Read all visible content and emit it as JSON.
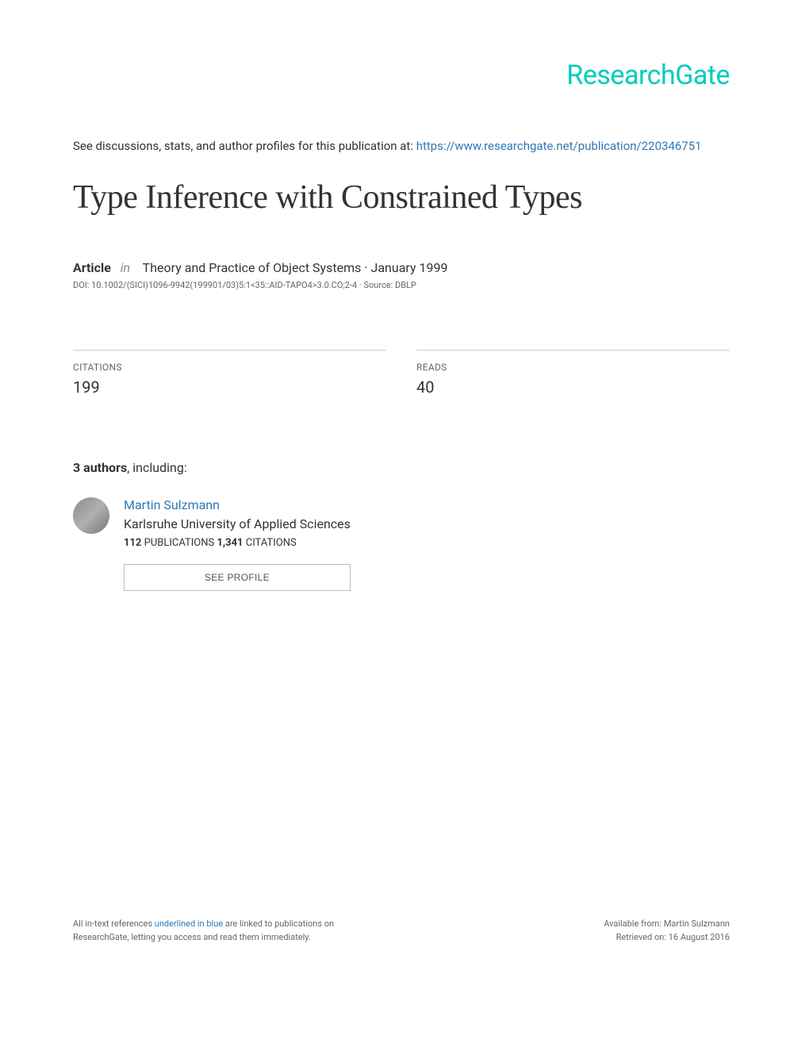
{
  "logo": "ResearchGate",
  "discussion": {
    "prefix": "See discussions, stats, and author profiles for this publication at: ",
    "url": "https://www.researchgate.net/publication/220346751"
  },
  "title": "Type Inference with Constrained Types",
  "meta": {
    "type": "Article",
    "in_word": "in",
    "journal": "Theory and Practice of Object Systems · January 1999"
  },
  "doi": "DOI: 10.1002/(SICI)1096-9942(199901/03)5:1<35::AID-TAPO4>3.0.CO;2-4 · Source: DBLP",
  "stats": {
    "citations": {
      "label": "CITATIONS",
      "value": "199"
    },
    "reads": {
      "label": "READS",
      "value": "40"
    }
  },
  "authors_header": {
    "count": "3 authors",
    "suffix": ", including:"
  },
  "author": {
    "name": "Martin Sulzmann",
    "affiliation": "Karlsruhe University of Applied Sciences",
    "pubs_count": "112",
    "pubs_label": " PUBLICATIONS   ",
    "cites_count": "1,341",
    "cites_label": " CITATIONS"
  },
  "see_profile": "SEE PROFILE",
  "footer": {
    "left_prefix": "All in-text references ",
    "left_blue": "underlined in blue",
    "left_suffix": " are linked to publications on ResearchGate, letting you access and read them immediately.",
    "right_line1": "Available from: Martin Sulzmann",
    "right_line2": "Retrieved on: 16 August 2016"
  }
}
